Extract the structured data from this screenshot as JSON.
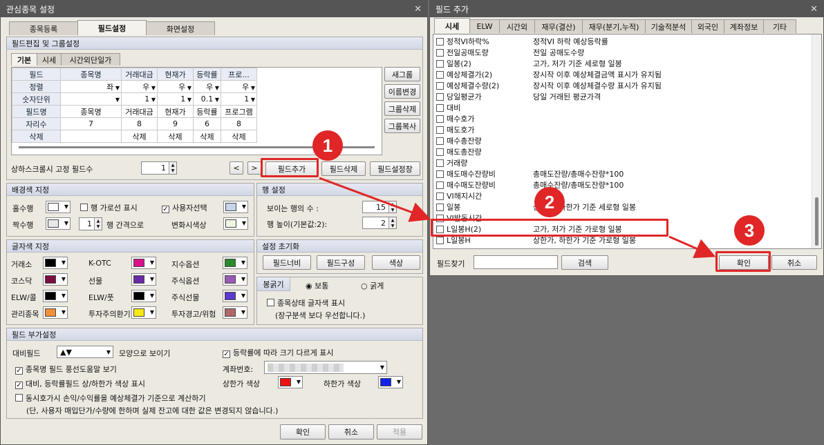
{
  "left": {
    "title": "관심종목 설정",
    "tabs": [
      "종목등록",
      "필드설정",
      "화면설정"
    ],
    "field_group": {
      "title": "필드편집 및 그룹설정",
      "subtabs": [
        "기본",
        "시세",
        "시간외단일가"
      ],
      "table": {
        "rows": [
          {
            "head": "필드",
            "cells": [
              "종목명",
              "거래대금",
              "현재가",
              "등락률",
              "프로..."
            ]
          },
          {
            "head": "정렬",
            "cells": [
              "좌",
              "우",
              "우",
              "우",
              "우"
            ]
          },
          {
            "head": "숫자단위",
            "cells": [
              "",
              "1",
              "1",
              "0.1",
              "1"
            ]
          },
          {
            "head": "필드명",
            "cells": [
              "종목명",
              "거래대금",
              "현재가",
              "등락률",
              "프로그램"
            ]
          },
          {
            "head": "자리수",
            "cells": [
              "7",
              "8",
              "9",
              "6",
              "8"
            ]
          },
          {
            "head": "삭제",
            "cells": [
              "",
              "삭제",
              "삭제",
              "삭제",
              "삭제"
            ]
          }
        ]
      },
      "side_buttons": [
        "새그룹",
        "이름변경",
        "그룹삭제",
        "그룹복사"
      ],
      "fixed_label": "상하스크롤시 고정 필드수",
      "fixed_value": "1",
      "nav_prev": "<",
      "nav_next": ">",
      "btn_add": "필드추가",
      "btn_delete": "필드삭제",
      "btn_window": "필드설정창"
    },
    "bg_group": {
      "title": "배경색 지정",
      "odd_label": "홀수행",
      "even_label": "짝수행",
      "row_line_label": "행 가로선 표시",
      "interval_value": "1",
      "interval_label": "행 간격으로",
      "user_select_label": "사용자선택",
      "change_color_label": "변화시색상"
    },
    "row_group": {
      "title": "행 설정",
      "visible_label": "보이는 행의 수 :",
      "visible_value": "15",
      "height_label": "행 높이(기본값:2):",
      "height_value": "2"
    },
    "font_group": {
      "title": "글자색 지정",
      "items": [
        "거래소",
        "K-OTC",
        "지수옵션",
        "코스닥",
        "선물",
        "주식옵션",
        "ELW/콜",
        "ELW/풋",
        "주식선물",
        "관리종목",
        "투자주의환기",
        "투자경고/위험"
      ],
      "colors": [
        "#000000",
        "#d8118c",
        "#2a8a2a",
        "#7a1040",
        "#6a2aa8",
        "#9a5ab8",
        "#000000",
        "#000000",
        "#5a3ad0",
        "#f0903a",
        "#f8e818",
        "#b06868"
      ]
    },
    "reset_group": {
      "title": "설정 초기화",
      "buttons": [
        "필드너비",
        "필드구성",
        "색상"
      ],
      "candle_label": "봉굵기",
      "candle_normal": "보통",
      "candle_bold": "굵게",
      "status_label": "종목상태 글자색 표시",
      "status_note": "(장구분색 보다 우선합니다.)"
    },
    "extra_group": {
      "title": "필드 부가설정",
      "compare_label": "대비필드",
      "compare_value": "▲▼",
      "compare_suffix": "모양으로 보이기",
      "size_label": "등락률에 따라 크기 다르게 표시",
      "tooltip_label": "종목명 필드 풍선도움말 보기",
      "account_label": "계좌번호:",
      "color_label": "대비, 등락률필드 상/하한가 색상 표시",
      "upper_label": "상한가 색상",
      "lower_label": "하한가 색상",
      "calc_label": "동시호가시 손익/수익률을 예상체결가 기준으로 계산하기",
      "calc_note": "(단, 사용자 매입단가/수량에 한하며 실제 잔고에 대한 값은 변경되지 않습니다.)"
    },
    "footer": {
      "ok": "확인",
      "cancel": "취소",
      "apply": "적용"
    }
  },
  "right": {
    "title": "필드 추가",
    "tabs": [
      "시세",
      "ELW",
      "시간외",
      "재무(결산)",
      "재무(분기,누적)",
      "기술적분석",
      "외국인",
      "계좌정보",
      "기타"
    ],
    "items": [
      {
        "name": "정적VI하락%",
        "desc": "정적VI 하락 예상등락률"
      },
      {
        "name": "전일공매도량",
        "desc": "전일 공매도수량"
      },
      {
        "name": "일봉(2)",
        "desc": "고가, 저가 기준 세로형 일봉"
      },
      {
        "name": "예상체결가(2)",
        "desc": "장시작 이후 예상체결금액 표시가 유지됨"
      },
      {
        "name": "예상체결수량(2)",
        "desc": "장시작 이후 예상체결수량 표시가 유지됨"
      },
      {
        "name": "당일평균가",
        "desc": "당일 거래된 평균가격"
      },
      {
        "name": "대비",
        "desc": ""
      },
      {
        "name": "매수호가",
        "desc": ""
      },
      {
        "name": "매도호가",
        "desc": ""
      },
      {
        "name": "매수총잔량",
        "desc": ""
      },
      {
        "name": "매도총잔량",
        "desc": ""
      },
      {
        "name": "거래량",
        "desc": ""
      },
      {
        "name": "매도매수잔량비",
        "desc": "총매도잔량/총매수잔량*100"
      },
      {
        "name": "매수매도잔량비",
        "desc": "총매수잔량/총매도잔량*100"
      },
      {
        "name": "VI해지시간",
        "desc": ""
      },
      {
        "name": "일봉",
        "desc": "상한가, 하한가 기준 세로형 일봉"
      },
      {
        "name": "VI발동시간",
        "desc": ""
      },
      {
        "name": "L일봉H(2)",
        "desc": "고가, 저가 기준 가로형 일봉"
      },
      {
        "name": "L일봉H",
        "desc": "상한가, 하한가 기준 가로형 일봉"
      }
    ],
    "search_label": "필드찾기",
    "search_button": "검색",
    "ok": "확인",
    "cancel": "취소"
  },
  "markers": [
    "1",
    "2",
    "3"
  ]
}
